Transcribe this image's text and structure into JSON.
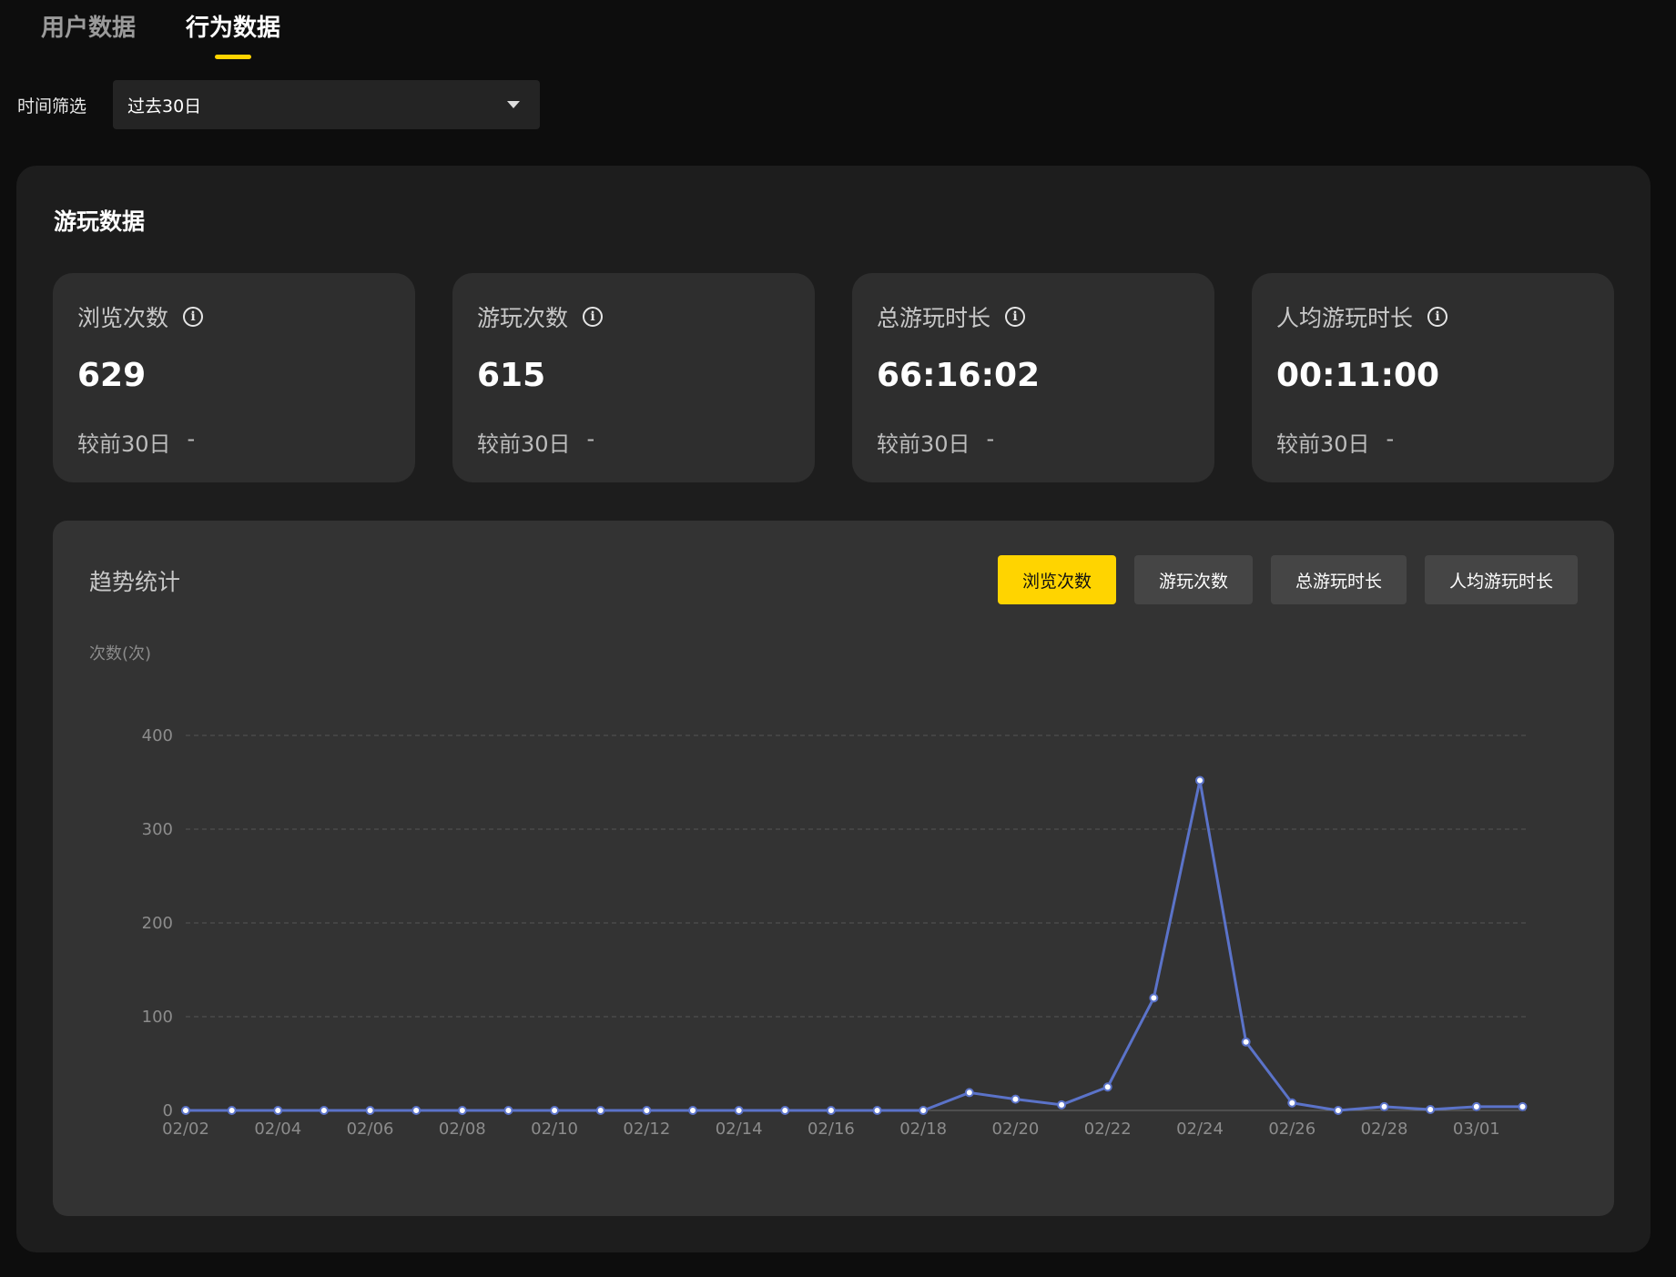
{
  "tabs": [
    {
      "label": "用户数据",
      "active": false
    },
    {
      "label": "行为数据",
      "active": true
    }
  ],
  "filter": {
    "label": "时间筛选",
    "value": "过去30日"
  },
  "panel": {
    "title": "游玩数据"
  },
  "cards": [
    {
      "label": "浏览次数",
      "value": "629",
      "compare_label": "较前30日",
      "compare_value": "-"
    },
    {
      "label": "游玩次数",
      "value": "615",
      "compare_label": "较前30日",
      "compare_value": "-"
    },
    {
      "label": "总游玩时长",
      "value": "66:16:02",
      "compare_label": "较前30日",
      "compare_value": "-"
    },
    {
      "label": "人均游玩时长",
      "value": "00:11:00",
      "compare_label": "较前30日",
      "compare_value": "-"
    }
  ],
  "trend": {
    "title": "趋势统计",
    "buttons": [
      {
        "label": "浏览次数",
        "active": true
      },
      {
        "label": "游玩次数",
        "active": false
      },
      {
        "label": "总游玩时长",
        "active": false
      },
      {
        "label": "人均游玩时长",
        "active": false
      }
    ],
    "y_unit": "次数(次)"
  },
  "colors": {
    "accent": "#ffd400",
    "line": "#5b73c9",
    "background": "#0d0d0d",
    "panel": "#1d1d1d",
    "card": "#2e2e2e"
  },
  "chart_data": {
    "type": "line",
    "x": [
      "02/02",
      "02/03",
      "02/04",
      "02/05",
      "02/06",
      "02/07",
      "02/08",
      "02/09",
      "02/10",
      "02/11",
      "02/12",
      "02/13",
      "02/14",
      "02/15",
      "02/16",
      "02/17",
      "02/18",
      "02/19",
      "02/20",
      "02/21",
      "02/22",
      "02/23",
      "02/24",
      "02/25",
      "02/26",
      "02/27",
      "02/28",
      "02/29",
      "03/01",
      "03/02"
    ],
    "x_tick_labels": [
      "02/02",
      "02/04",
      "02/06",
      "02/08",
      "02/10",
      "02/12",
      "02/14",
      "02/16",
      "02/18",
      "02/20",
      "02/22",
      "02/24",
      "02/26",
      "02/28",
      "03/01"
    ],
    "series": [
      {
        "values": [
          0,
          0,
          0,
          0,
          0,
          0,
          0,
          0,
          0,
          0,
          0,
          0,
          0,
          0,
          0,
          0,
          0,
          19,
          12,
          6,
          25,
          120,
          352,
          73,
          8,
          0,
          4,
          1,
          4,
          4
        ]
      }
    ],
    "ylabel": "次数(次)",
    "ylim": [
      0,
      400
    ],
    "y_ticks": [
      0,
      100,
      200,
      300,
      400
    ],
    "grid": true
  }
}
